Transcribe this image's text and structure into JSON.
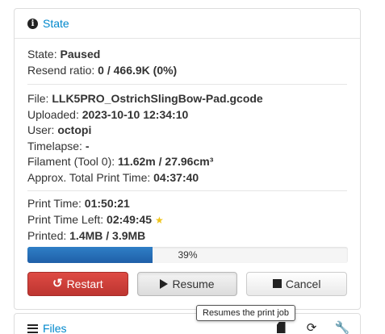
{
  "state_panel": {
    "title": "State",
    "state_label": "State:",
    "state_value": "Paused",
    "resend_label": "Resend ratio:",
    "resend_value": "0 / 466.9K (0%)",
    "file_label": "File:",
    "file_value": "LLK5PRO_OstrichSlingBow-Pad.gcode",
    "uploaded_label": "Uploaded:",
    "uploaded_value": "2023-10-10 12:34:10",
    "user_label": "User:",
    "user_value": "octopi",
    "timelapse_label": "Timelapse:",
    "timelapse_value": "-",
    "filament_label": "Filament (Tool 0):",
    "filament_value": "11.62m / 27.96cm³",
    "approx_label": "Approx. Total Print Time:",
    "approx_value": "04:37:40",
    "print_time_label": "Print Time:",
    "print_time_value": "01:50:21",
    "time_left_label": "Print Time Left:",
    "time_left_value": "02:49:45",
    "printed_label": "Printed:",
    "printed_value": "1.4MB / 3.9MB",
    "progress_text": "39%",
    "progress_fraction": 0.39,
    "colors": {
      "progress": "#2a70b8",
      "restart": "#c9302c",
      "link": "#0088cc",
      "star": "#f0c419"
    }
  },
  "buttons": {
    "restart": "Restart",
    "resume": "Resume",
    "cancel": "Cancel"
  },
  "tooltip": "Resumes the print job",
  "files_panel": {
    "title": "Files",
    "tools": [
      "sd-card-icon",
      "refresh-icon",
      "wrench-icon"
    ]
  }
}
